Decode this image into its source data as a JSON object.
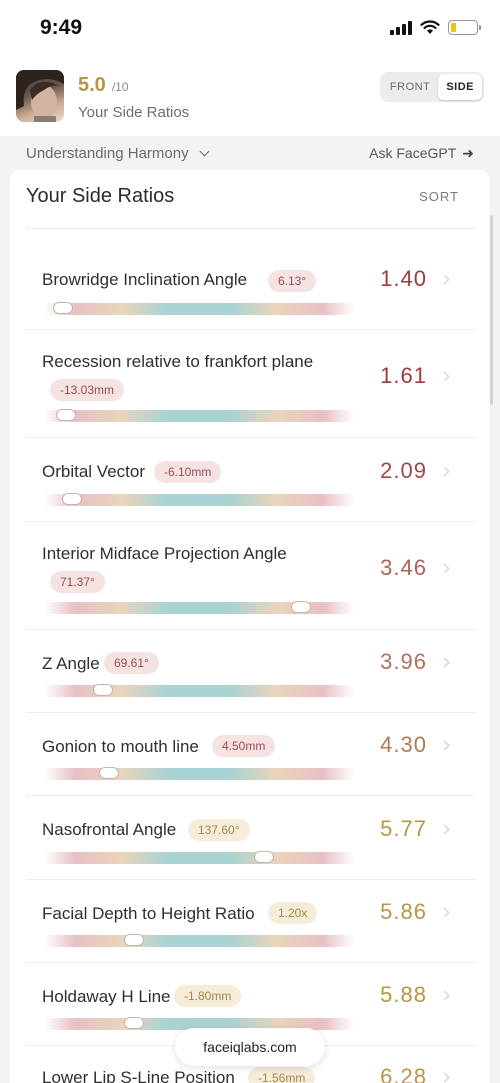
{
  "status": {
    "time": "9:49",
    "battery_level": 0.2
  },
  "header": {
    "score": "5.0",
    "score_max": "/10",
    "subtitle": "Your Side Ratios",
    "segment": {
      "front_label": "FRONT",
      "side_label": "SIDE",
      "selected": "SIDE"
    }
  },
  "harmony": {
    "label": "Understanding Harmony",
    "ask_label": "Ask FaceGPT"
  },
  "card": {
    "title": "Your Side Ratios",
    "sort_label": "SORT"
  },
  "ratios": [
    {
      "name": "Browridge Inclination Angle",
      "measure": "6.13°",
      "score": "1.40",
      "position": 0.06,
      "score_color": "#9e3a3f",
      "chip_bg": "#f5e3e4",
      "chip_color": "#9b4d53"
    },
    {
      "name": "Recession relative to frankfort plane",
      "measure": "-13.03mm",
      "score": "1.61",
      "position": 0.07,
      "score_color": "#9e3a3f",
      "chip_bg": "#f5e3e4",
      "chip_color": "#9b4d53"
    },
    {
      "name": "Orbital Vector",
      "measure": "-6.10mm",
      "score": "2.09",
      "position": 0.09,
      "score_color": "#a0464a",
      "chip_bg": "#f5e3e4",
      "chip_color": "#9b4d53"
    },
    {
      "name": "Interior Midface Projection Angle",
      "measure": "71.37°",
      "score": "3.46",
      "position": 0.83,
      "score_color": "#b06256",
      "chip_bg": "#f5e3e4",
      "chip_color": "#9b4d53"
    },
    {
      "name": "Z Angle",
      "measure": "69.61°",
      "score": "3.96",
      "position": 0.19,
      "score_color": "#b3715a",
      "chip_bg": "#f5e3e4",
      "chip_color": "#9b4d53"
    },
    {
      "name": "Gonion to mouth line",
      "measure": "4.50mm",
      "score": "4.30",
      "position": 0.21,
      "score_color": "#b37a55",
      "chip_bg": "#f5e3e4",
      "chip_color": "#9b4d53"
    },
    {
      "name": "Nasofrontal Angle",
      "measure": "137.60°",
      "score": "5.77",
      "position": 0.71,
      "score_color": "#b99646",
      "chip_bg": "#f5ecd9",
      "chip_color": "#a5874a"
    },
    {
      "name": "Facial Depth to Height Ratio",
      "measure": "1.20x",
      "score": "5.86",
      "position": 0.29,
      "score_color": "#b99646",
      "chip_bg": "#f5ecd9",
      "chip_color": "#a5874a"
    },
    {
      "name": "Holdaway H Line",
      "measure": "-1.80mm",
      "score": "5.88",
      "position": 0.29,
      "score_color": "#b99646",
      "chip_bg": "#f5ecd9",
      "chip_color": "#a5874a"
    },
    {
      "name": "Lower Lip S-Line Position",
      "measure": "-1.56mm",
      "score": "6.28",
      "score_color": "#b99646",
      "chip_bg": "#f5ecd9",
      "chip_color": "#a5874a"
    }
  ],
  "footer": {
    "url": "faceiqlabs.com"
  }
}
